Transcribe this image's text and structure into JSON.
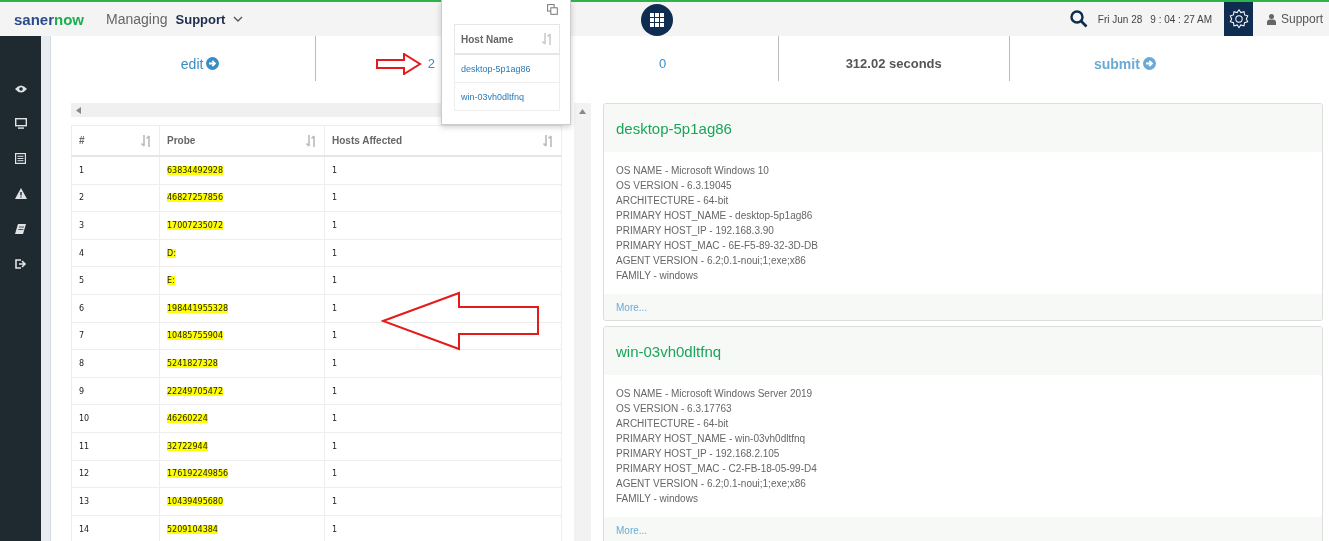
{
  "header": {
    "logo": {
      "first": "saner",
      "second": "now"
    },
    "managing_label": "Managing",
    "account": "Support",
    "date": "Fri Jun 28",
    "time": "9 : 04 : 27 AM",
    "user": "Support"
  },
  "summary": [
    {
      "kind": "link",
      "text": "edit"
    },
    {
      "kind": "count",
      "text": "2"
    },
    {
      "kind": "count",
      "text": "0"
    },
    {
      "kind": "plain",
      "text": "312.02 seconds"
    },
    {
      "kind": "link",
      "text": "submit"
    }
  ],
  "popover": {
    "column": "Host Name",
    "rows": [
      "desktop-5p1ag86",
      "win-03vh0dltfnq"
    ]
  },
  "table": {
    "columns": [
      "#",
      "Probe",
      "Hosts Affected"
    ],
    "rows": [
      [
        "1",
        "63834492928",
        "1"
      ],
      [
        "2",
        "46827257856",
        "1"
      ],
      [
        "3",
        "17007235072",
        "1"
      ],
      [
        "4",
        "D:",
        "1"
      ],
      [
        "5",
        "E:",
        "1"
      ],
      [
        "6",
        "198441955328",
        "1"
      ],
      [
        "7",
        "10485755904",
        "1"
      ],
      [
        "8",
        "5241827328",
        "1"
      ],
      [
        "9",
        "22249705472",
        "1"
      ],
      [
        "10",
        "46260224",
        "1"
      ],
      [
        "11",
        "32722944",
        "1"
      ],
      [
        "12",
        "176192249856",
        "1"
      ],
      [
        "13",
        "10439495680",
        "1"
      ],
      [
        "14",
        "5209104384",
        "1"
      ]
    ]
  },
  "hosts": [
    {
      "name": "desktop-5p1ag86",
      "details": [
        "OS NAME - Microsoft Windows 10",
        "OS VERSION - 6.3.19045",
        "ARCHITECTURE - 64-bit",
        "PRIMARY HOST_NAME - desktop-5p1ag86",
        "PRIMARY HOST_IP - 192.168.3.90",
        "PRIMARY HOST_MAC - 6E-F5-89-32-3D-DB",
        "AGENT VERSION - 6.2;0.1-noui;1;exe;x86",
        "FAMILY - windows"
      ],
      "more": "More..."
    },
    {
      "name": "win-03vh0dltfnq",
      "details": [
        "OS NAME - Microsoft Windows Server 2019",
        "OS VERSION - 6.3.17763",
        "ARCHITECTURE - 64-bit",
        "PRIMARY HOST_NAME - win-03vh0dltfnq",
        "PRIMARY HOST_IP - 192.168.2.105",
        "PRIMARY HOST_MAC - C2-FB-18-05-99-D4",
        "AGENT VERSION - 6.2;0.1-noui;1;exe;x86",
        "FAMILY - windows"
      ],
      "more": "More..."
    }
  ]
}
